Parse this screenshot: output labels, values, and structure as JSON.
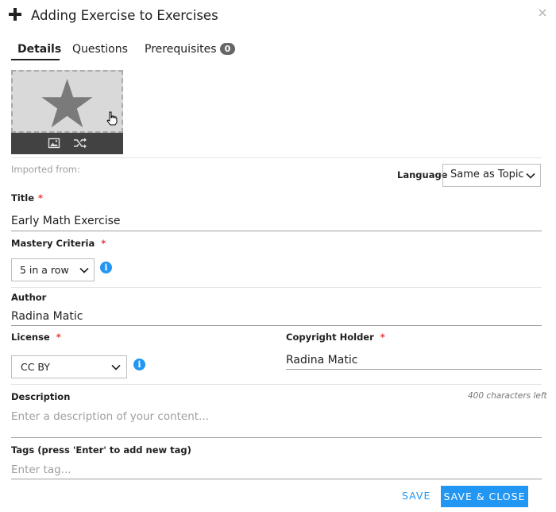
{
  "header": {
    "title": "Adding Exercise to Exercises"
  },
  "tabs": [
    {
      "label": "Details",
      "active": true
    },
    {
      "label": "Questions"
    },
    {
      "label": "Prerequisites",
      "badge": "0"
    }
  ],
  "thumbnail": {
    "placeholder_icon": "star-icon",
    "actions": [
      "image-icon",
      "shuffle-icon"
    ]
  },
  "imported_from": {
    "label": "Imported from:"
  },
  "language": {
    "label": "Language",
    "value": "Same as Topic"
  },
  "title_field": {
    "label": "Title",
    "required_mark": "*",
    "value": "Early Math Exercise"
  },
  "mastery": {
    "label": "Mastery Criteria",
    "required_mark": "*",
    "value": "5 in a row",
    "info_icon": "i"
  },
  "author": {
    "label": "Author",
    "value": "Radina Matic"
  },
  "license": {
    "label": "License",
    "required_mark": "*",
    "value": "CC BY",
    "info_icon": "i"
  },
  "copyright": {
    "label": "Copyright Holder",
    "required_mark": "*",
    "value": "Radina Matic"
  },
  "description": {
    "label": "Description",
    "counter": "400 characters left",
    "placeholder": "Enter a description of your content..."
  },
  "tags": {
    "label": "Tags (press 'Enter' to add new tag)",
    "placeholder": "Enter tag..."
  },
  "footer": {
    "save_label": "SAVE",
    "save_close_label": "SAVE & CLOSE"
  },
  "colors": {
    "accent": "#2196f3",
    "required": "#e53935",
    "thumb_bar": "#424242"
  }
}
